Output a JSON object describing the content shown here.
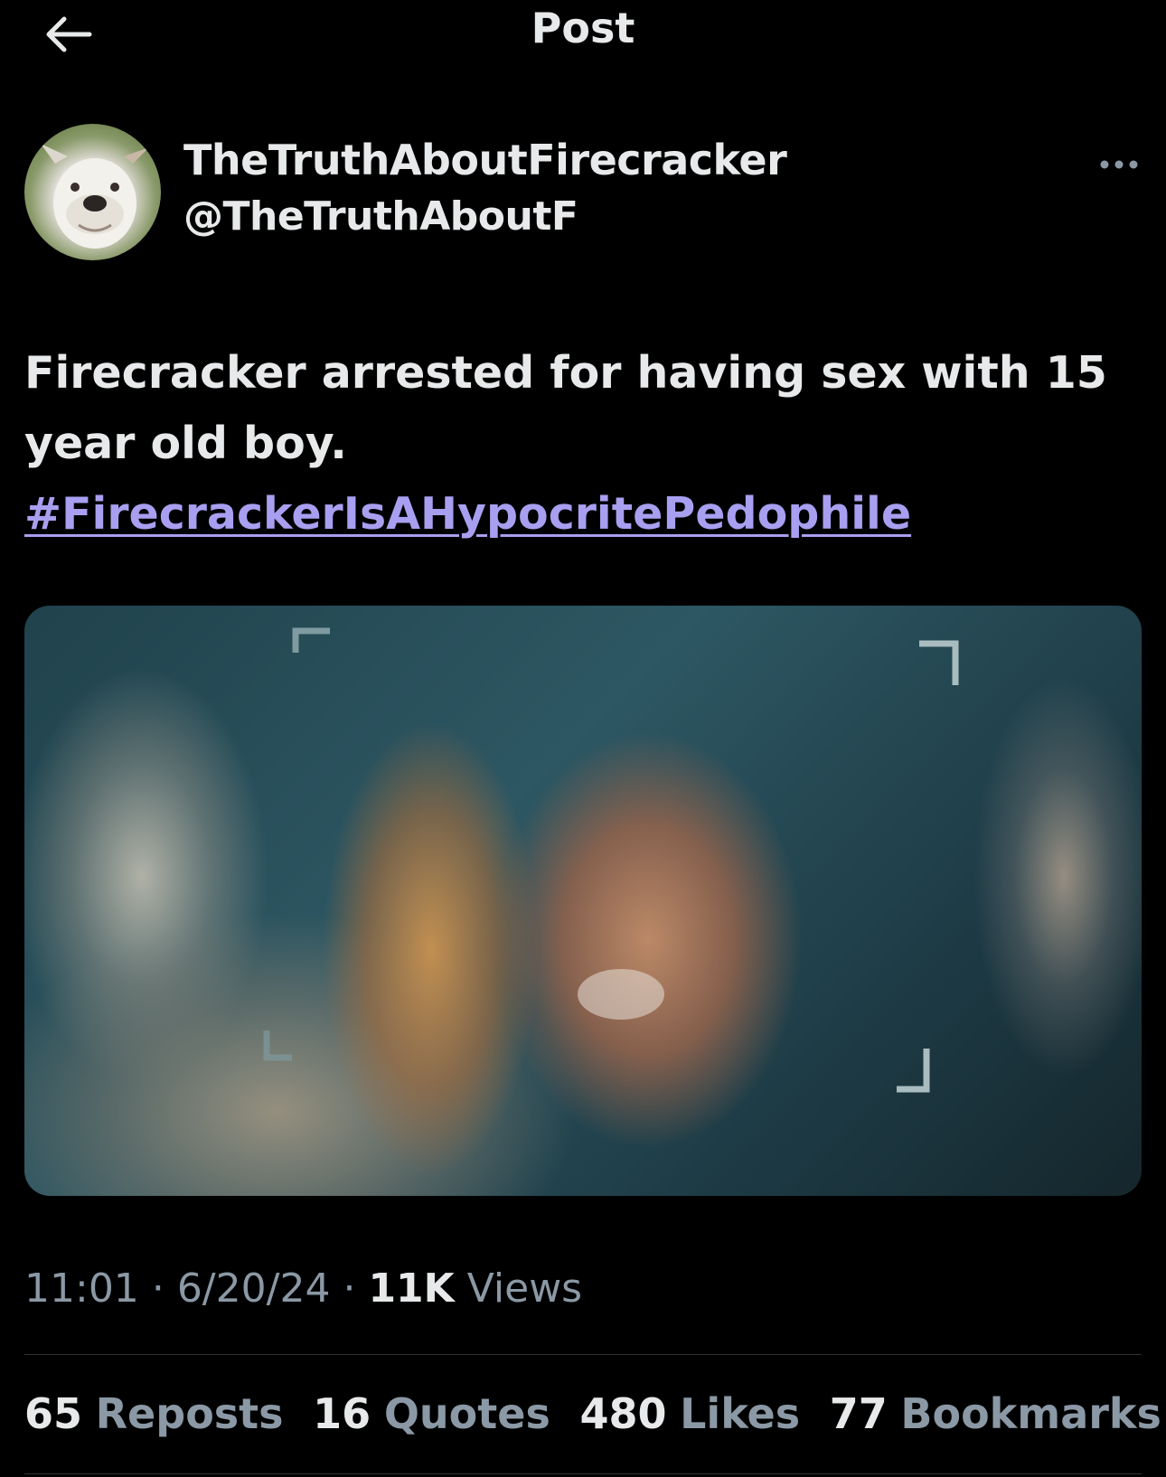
{
  "header": {
    "back_icon": "arrow-left-icon",
    "title": "Post"
  },
  "author": {
    "display_name": "TheTruthAboutFirecracker",
    "handle": "@TheTruthAboutF",
    "more_icon": "ellipsis-icon"
  },
  "post": {
    "text": "Firecracker arrested for having sex with 15 year old boy.",
    "hashtag": "#FirecrackerIsAHypocritePedophile"
  },
  "meta": {
    "time": "11:01",
    "separator": "·",
    "date": "6/20/24",
    "views_count": "11K",
    "views_label": "Views"
  },
  "stats": {
    "reposts_count": "65",
    "reposts_label": "Reposts",
    "quotes_count": "16",
    "quotes_label": "Quotes",
    "likes_count": "480",
    "likes_label": "Likes",
    "bookmarks_count": "77",
    "bookmarks_label": "Bookmarks"
  },
  "colors": {
    "background": "#000000",
    "text": "#e7e9ea",
    "secondary": "#8b98a5",
    "hashtag": "#a99ff0",
    "divider": "#2f3336"
  }
}
